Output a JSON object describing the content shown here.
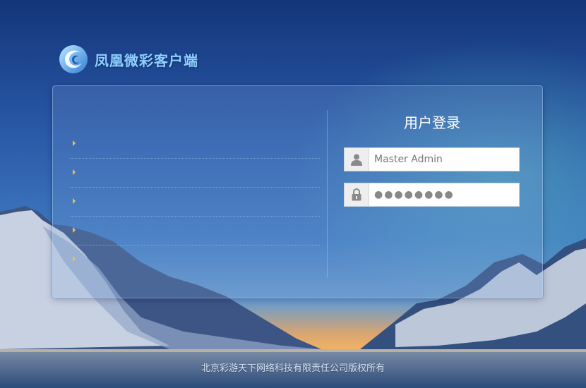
{
  "brand": {
    "name": "凤凰微彩客户端"
  },
  "news": {
    "items": [
      {
        "text": ""
      },
      {
        "text": ""
      },
      {
        "text": ""
      },
      {
        "text": ""
      },
      {
        "text": ""
      }
    ]
  },
  "login": {
    "title": "用户登录",
    "username": {
      "value": "Master Admin",
      "icon": "user-icon"
    },
    "password": {
      "value": "●●●●●●●●",
      "icon": "lock-icon"
    }
  },
  "footer": {
    "copyright": "北京彩游天下网络科技有限责任公司版权所有"
  },
  "colors": {
    "accent_bullet": "#f2c14a",
    "brand_text": "#8fd0ff"
  }
}
